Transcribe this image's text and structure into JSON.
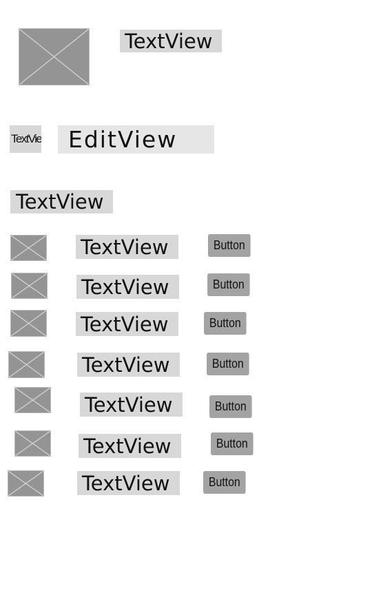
{
  "header": {
    "title_text": "TextView",
    "image_icon": "image-placeholder-icon"
  },
  "edit_row": {
    "small_label": "TextView",
    "edit_text": "EditView"
  },
  "section": {
    "label": "TextView"
  },
  "list": {
    "items": [
      {
        "text": "TextView",
        "button": "Button"
      },
      {
        "text": "TextView",
        "button": "Button"
      },
      {
        "text": "TextView",
        "button": "Button"
      },
      {
        "text": "TextView",
        "button": "Button"
      },
      {
        "text": "TextView",
        "button": "Button"
      },
      {
        "text": "TextView",
        "button": "Button"
      },
      {
        "text": "TextView",
        "button": "Button"
      }
    ]
  },
  "colors": {
    "image_fill": "#949494",
    "textview_bg": "#d8d8d8",
    "editview_bg": "#e6e6e6",
    "button_bg": "#a3a3a3"
  }
}
